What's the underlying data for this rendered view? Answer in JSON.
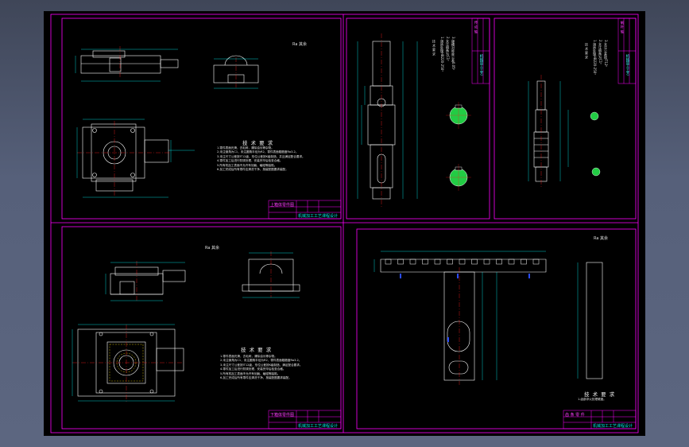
{
  "drawings": [
    {
      "sheet": "top-left",
      "tech_title": "技 术 要 求",
      "tech_notes": [
        "1.零件表面光滑，去毛刺，清除油污等杂物。",
        "2.未注倒角为C1，未注圆角半径为R2，零件表面粗糙度Ra3.2。",
        "3.未注尺寸公差按IT12级，形位公差按K级制造，并且满足配合要求。",
        "4.零件加工后进行防锈处理，安装完毕后检查合格。",
        "5.所有机加工表面不允许有划痕、磕碰等缺陷。",
        "6.加工完成后所有零件应清洗干净，按装配图要求装配。"
      ],
      "roughness": "Ra 其余",
      "title_block": "上箱体零件图",
      "school_text": "机械加工工艺课程设计"
    },
    {
      "sheet": "top-middle",
      "tech_title": "技 术 要 求",
      "tech_notes": [
        "1.调质处理HB220-250。",
        "2.未注倒角为C1。",
        "3.键槽对称度公差0.05。"
      ],
      "title_block": "传 动 轴",
      "school_text": "机械加工工艺"
    },
    {
      "sheet": "top-right",
      "tech_title": "技 术 要 求",
      "tech_notes": [
        "1.调质处理HB220-250。",
        "2.未注倒角为C1。",
        "3.未注公差按IT12。"
      ],
      "title_block": "蜗 杆 轴",
      "school_text": "机械加工工艺"
    },
    {
      "sheet": "bottom-left",
      "tech_title": "技 术 要 求",
      "tech_notes": [
        "1.零件表面光滑，去毛刺，清除油污等杂物。",
        "2.未注倒角为C1，未注圆角半径为R2，零件表面粗糙度Ra3.2。",
        "3.未注尺寸公差按IT12级，形位公差按K级制造，满足配合要求。",
        "4.零件加工后进行防锈处理，安装完毕后检查合格。",
        "5.所有机加工表面不允许有划痕、磕碰等缺陷。",
        "6.加工完成后所有零件应清洗干净，按装配图要求装配。"
      ],
      "roughness": "Ra 其余",
      "title_block": "下箱体零件图",
      "school_text": "机械加工工艺课程设计"
    },
    {
      "sheet": "bottom-right",
      "tech_title": "技 术 要 求",
      "tech_notes": [
        "1.齿部淬火处理硬度。"
      ],
      "roughness": "Ra 其余",
      "title_block": "齿 条 零 件",
      "school_text": "机械加工工艺课程设计"
    }
  ],
  "colors": {
    "background": "#000000",
    "border": "#ff00ff",
    "outline": "#ffffff",
    "dimension": "#00ffff",
    "centerline": "#ff2020",
    "section_fill": "#22cc44"
  }
}
